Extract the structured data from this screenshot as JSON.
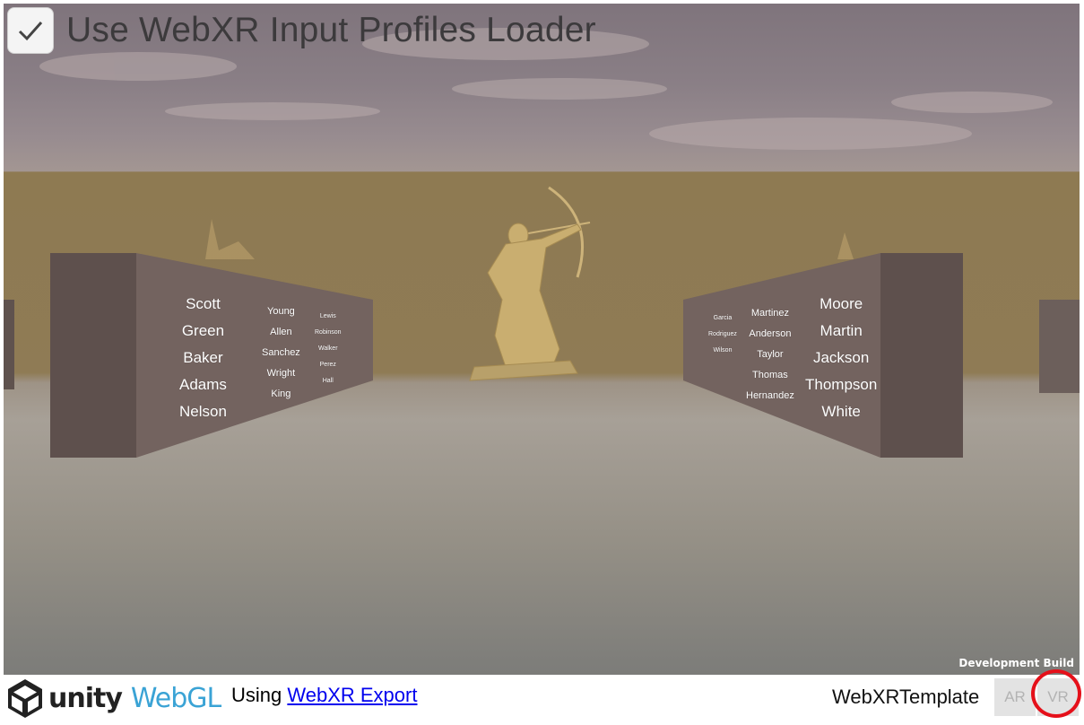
{
  "overlay": {
    "toggle_label": "Use WebXR Input Profiles Loader",
    "toggle_checked": true,
    "dev_build": "Development Build"
  },
  "scene": {
    "left_wall": {
      "column1": [
        "Scott",
        "Green",
        "Baker",
        "Adams",
        "Nelson"
      ],
      "column2": [
        "Young",
        "Allen",
        "Sanchez",
        "Wright",
        "King"
      ],
      "column3": [
        "Lewis",
        "Robinson",
        "Walker",
        "Perez",
        "Hall"
      ]
    },
    "right_wall": {
      "column1": [
        "Moore",
        "Martin",
        "Jackson",
        "Thompson",
        "White"
      ],
      "column2": [
        "Martinez",
        "Anderson",
        "Taylor",
        "Thomas",
        "Hernandez"
      ],
      "column3": [
        "Garcia",
        "Rodriguez",
        "Wilson"
      ]
    },
    "colors": {
      "sky": "#8a7f86",
      "back_wall": "#8f7b55",
      "floor": "#a7a097",
      "panel": "#6f605d",
      "statue": "#c9ae70"
    }
  },
  "footer": {
    "unity_text": "unity",
    "webgl_text": "WebGL",
    "using_text": "Using",
    "link_text": "WebXR Export",
    "template_title": "WebXRTemplate",
    "ar_button": "AR",
    "vr_button": "VR",
    "highlight_color": "#e5101a"
  }
}
